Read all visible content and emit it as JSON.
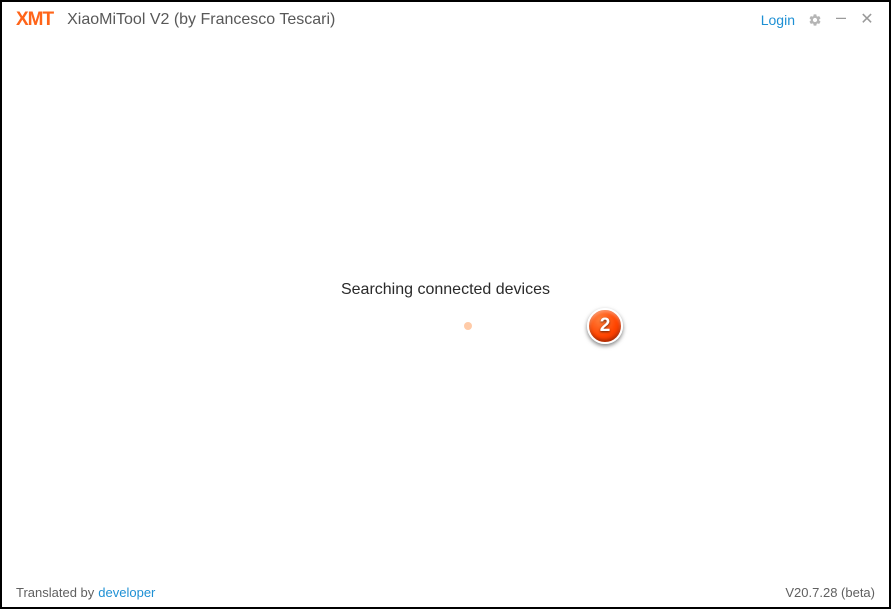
{
  "header": {
    "logo_text": "XMT",
    "app_title": "XiaoMiTool V2 (by Francesco Tescari)",
    "login_label": "Login"
  },
  "main": {
    "status": "Searching connected devices",
    "annotation_number": "2"
  },
  "footer": {
    "translated_by": "Translated by",
    "translator": "developer",
    "version": "V20.7.28 (beta)"
  }
}
